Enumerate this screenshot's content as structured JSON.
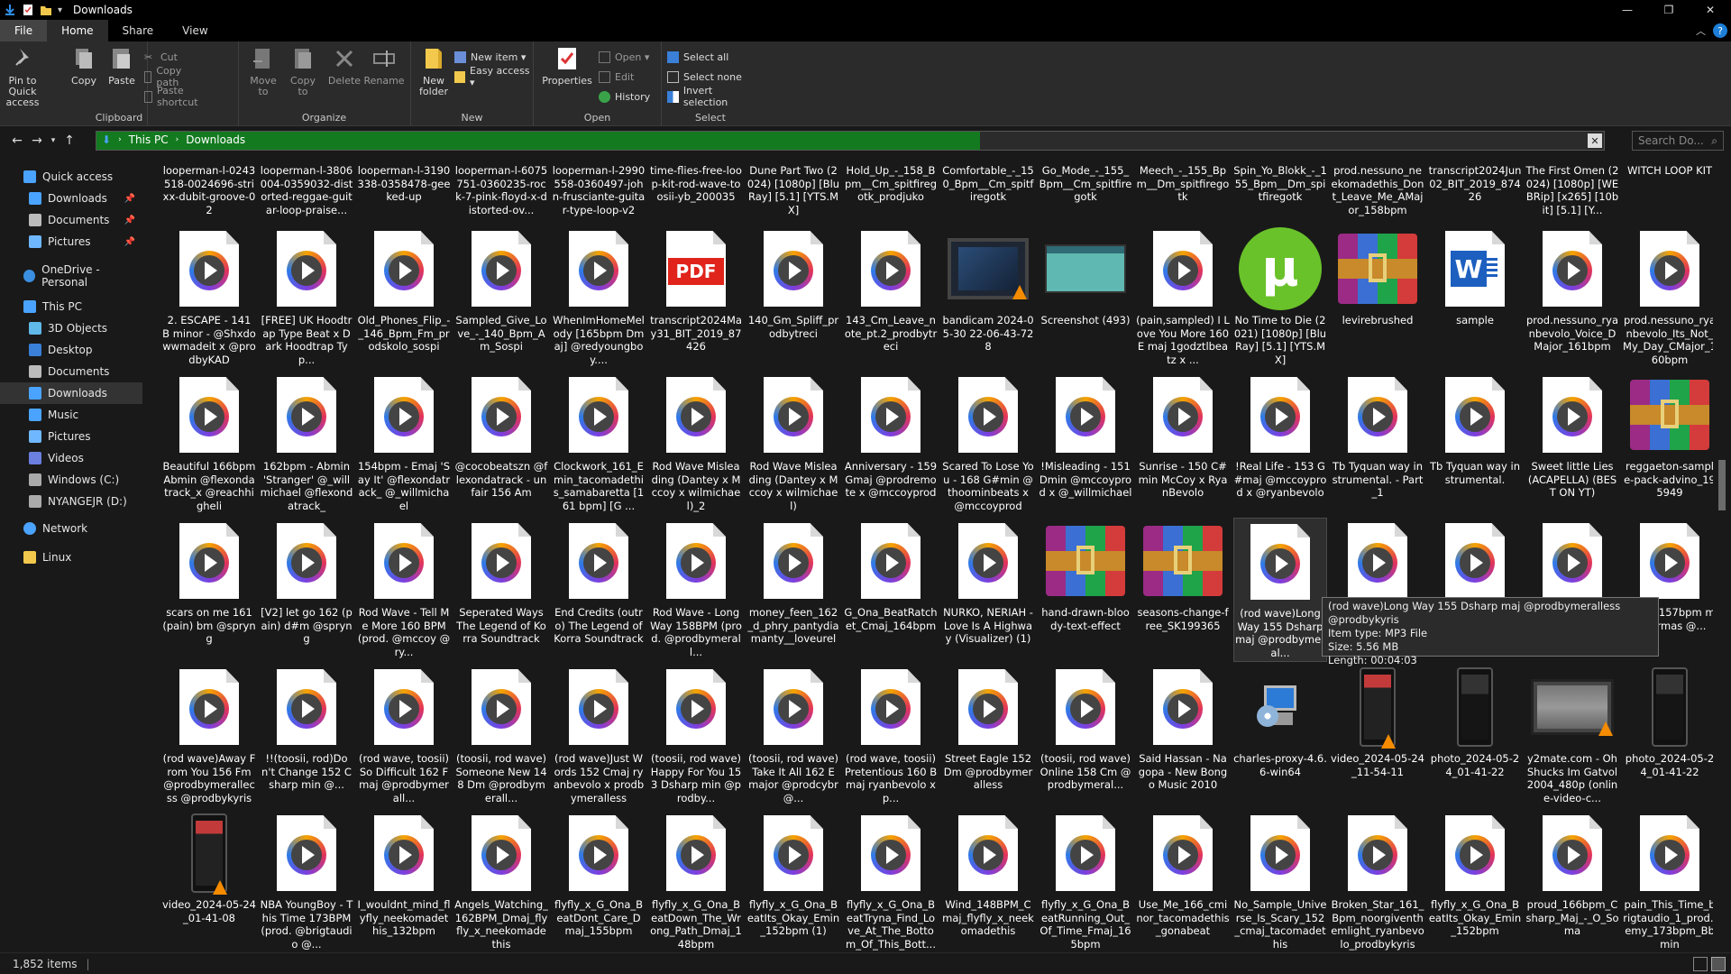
{
  "window": {
    "title": "Downloads",
    "controls": [
      "—",
      "❐",
      "✕"
    ]
  },
  "ribbon_tabs": [
    {
      "label": "File"
    },
    {
      "label": "Home"
    },
    {
      "label": "Share"
    },
    {
      "label": "View"
    }
  ],
  "ribbon": {
    "clipboard": {
      "label": "Clipboard",
      "pin": "Pin to Quick access",
      "copy": "Copy",
      "paste": "Paste",
      "cut": "Cut",
      "copy_path": "Copy path",
      "paste_shortcut": "Paste shortcut"
    },
    "organize": {
      "label": "Organize",
      "move_to": "Move to",
      "copy_to": "Copy to",
      "delete": "Delete",
      "rename": "Rename"
    },
    "new": {
      "label": "New",
      "new_folder": "New folder",
      "new_item": "New item ▾",
      "easy_access": "Easy access ▾"
    },
    "open": {
      "label": "Open",
      "properties": "Properties",
      "open": "Open ▾",
      "edit": "Edit",
      "history": "History"
    },
    "select": {
      "label": "Select",
      "select_all": "Select all",
      "select_none": "Select none",
      "invert": "Invert selection"
    }
  },
  "address": {
    "crumbs": [
      "This PC",
      "Downloads"
    ],
    "progress": 0.586,
    "search_placeholder": "Search Do..."
  },
  "nav": [
    {
      "label": "Quick access",
      "icon": "star-icon"
    },
    {
      "label": "Downloads",
      "icon": "download-icon",
      "pinned": true
    },
    {
      "label": "Documents",
      "icon": "document-icon",
      "pinned": true
    },
    {
      "label": "Pictures",
      "icon": "picture-icon",
      "pinned": true
    },
    {
      "label": "OneDrive - Personal",
      "icon": "cloud-icon"
    },
    {
      "label": "This PC",
      "icon": "computer-icon"
    },
    {
      "label": "3D Objects",
      "icon": "cube-icon"
    },
    {
      "label": "Desktop",
      "icon": "desktop-icon"
    },
    {
      "label": "Documents",
      "icon": "document-icon"
    },
    {
      "label": "Downloads",
      "icon": "download-icon",
      "selected": true
    },
    {
      "label": "Music",
      "icon": "music-icon"
    },
    {
      "label": "Pictures",
      "icon": "picture-icon"
    },
    {
      "label": "Videos",
      "icon": "video-icon"
    },
    {
      "label": "Windows (C:)",
      "icon": "drive-icon"
    },
    {
      "label": "NYANGEJR (D:)",
      "icon": "drive-icon"
    },
    {
      "label": "Network",
      "icon": "network-icon"
    },
    {
      "label": "Linux",
      "icon": "linux-icon"
    }
  ],
  "rows": [
    [
      {
        "name": "looperman-l-0243518-0024696-strixx-dubit-groove-02",
        "type": "audio"
      },
      {
        "name": "looperman-l-3806004-0359032-distorted-reggae-guitar-loop-praise...",
        "type": "audio"
      },
      {
        "name": "looperman-l-3190338-0358478-geeked-up",
        "type": "audio"
      },
      {
        "name": "looperman-l-6075751-0360235-rock-7-pink-floyd-x-distorted-ov...",
        "type": "audio"
      },
      {
        "name": "looperman-l-2990558-0360497-john-frusciante-guitar-type-loop-v2",
        "type": "audio"
      },
      {
        "name": "time-flies-free-loop-kit-rod-wave-toosii-yb_200035",
        "type": "audio"
      },
      {
        "name": "Dune Part Two (2024) [1080p] [BluRay] [5.1] [YTS.MX]",
        "type": "utorrent"
      },
      {
        "name": "Hold_Up_-_158_Bpm__Cm_spitfiregotk_prodjuko",
        "type": "audio"
      },
      {
        "name": "Comfortable_-_150_Bpm__Cm_spitfiregotk",
        "type": "audio"
      },
      {
        "name": "Go_Mode_-_155_Bpm__Cm_spitfiregotk",
        "type": "audio"
      },
      {
        "name": "Meech_-_155_Bpm__Dm_spitfiregotk",
        "type": "audio"
      },
      {
        "name": "Spin_Yo_Blokk_-_155_Bpm__Dm_spitfiregotk",
        "type": "audio"
      },
      {
        "name": "prod.nessuno_neekomadethis_Dont_Leave_Me_AMajor_158bpm",
        "type": "audio"
      },
      {
        "name": "transcript2024Jun02_BIT_2019_87426",
        "type": "pdf"
      },
      {
        "name": "The First Omen (2024) [1080p] [WEBRip] [x265] [10bit] [5.1] [Y...",
        "type": "utorrent"
      },
      {
        "name": "WITCH LOOP KIT",
        "type": "rar"
      }
    ],
    [
      {
        "name": "2. ESCAPE - 141 B minor - @Shxdowwmadeit x @prodbyKAD",
        "type": "audio"
      },
      {
        "name": "[FREE] UK Hoodtrap Type Beat x Dark Hoodtrap Typ...",
        "type": "audio"
      },
      {
        "name": "Old_Phones_Flip_-_146_Bpm_Fm_prodskolo_sospi",
        "type": "audio"
      },
      {
        "name": "Sampled_Give_Love_-_140_Bpm_Am_Sospi",
        "type": "audio"
      },
      {
        "name": "WhenImHomeMelody [165bpm Dmaj] @redyoungboy....",
        "type": "audio"
      },
      {
        "name": "transcript2024May31_BIT_2019_87426",
        "type": "pdf"
      },
      {
        "name": "140_Gm_Spliff_prodbytreci",
        "type": "audio"
      },
      {
        "name": "143_Cm_Leave_note_pt.2_prodbytreci",
        "type": "audio"
      },
      {
        "name": "bandicam 2024-05-30 22-06-43-728",
        "type": "video"
      },
      {
        "name": "Screenshot (493)",
        "type": "screenshot"
      },
      {
        "name": "(pain,sampled) I Love You More 160 E maj 1godztlbeatz x ...",
        "type": "audio"
      },
      {
        "name": "No Time to Die (2021) [1080p] [BluRay] [5.1] [YTS.MX]",
        "type": "utorrent"
      },
      {
        "name": "levirebrushed",
        "type": "rar"
      },
      {
        "name": "sample",
        "type": "word"
      },
      {
        "name": "prod.nessuno_ryanbevolo_Voice_DMajor_161bpm",
        "type": "audio"
      },
      {
        "name": "prod.nessuno_ryanbevolo_Its_Not_My_Day_CMajor_160bpm",
        "type": "audio"
      }
    ],
    [
      {
        "name": "Beautiful 166bpm Abmin @flexondatrack_x @reachhigheli",
        "type": "audio"
      },
      {
        "name": "162bpm - Abmin 'Stranger' @_willmichael @flexondatrack_",
        "type": "audio"
      },
      {
        "name": "154bpm - Emaj 'Say It' @flexondatrack_ @_willmichael",
        "type": "audio"
      },
      {
        "name": "@cocobeatszn @flexondatrack - unfair 156 Am",
        "type": "audio"
      },
      {
        "name": "Clockwork_161_Emin_tacomadethis_samabaretta [161 bpm] [G ...",
        "type": "audio"
      },
      {
        "name": "Rod Wave Misleading (Dantey x Mccoy x wilmichael)_2",
        "type": "audio"
      },
      {
        "name": "Rod Wave Misleading (Dantey x Mccoy x wilmichael)",
        "type": "audio"
      },
      {
        "name": "Anniversary - 159 Gmaj @prodremote x @mccoyprod",
        "type": "audio"
      },
      {
        "name": "Scared To Lose You - 168 G#min @thoominbeats x @mccoyprod",
        "type": "audio"
      },
      {
        "name": "!Misleading - 151 Dmin @mccoyprod x @_willmichael",
        "type": "audio"
      },
      {
        "name": "Sunrise - 150 C#min McCoy x RyanBevolo",
        "type": "audio"
      },
      {
        "name": "!Real Life - 153 G#maj @mccoyprod x @ryanbevolo",
        "type": "audio"
      },
      {
        "name": "Tb Tyquan way instrumental. - Part_1",
        "type": "audio"
      },
      {
        "name": "Tb Tyquan way instrumental.",
        "type": "audio"
      },
      {
        "name": "Sweet little Lies (ACAPELLA) (BEST ON YT)",
        "type": "audio"
      },
      {
        "name": "reggaeton-sample-pack-advino_195949",
        "type": "rar"
      }
    ],
    [
      {
        "name": "scars on me 161 (pain) bm @spryng",
        "type": "audio"
      },
      {
        "name": "[V2] let go 162 (pain) d#m @spryng",
        "type": "audio"
      },
      {
        "name": "Rod Wave - Tell Me More 160 BPM (prod. @mccoy @ry...",
        "type": "audio"
      },
      {
        "name": "Seperated Ways The Legend of Korra Soundtrack",
        "type": "audio"
      },
      {
        "name": "End Credits (outro) The Legend of Korra Soundtrack",
        "type": "audio"
      },
      {
        "name": "Rod Wave - Long Way 158BPM (prod. @prodbymerall...",
        "type": "audio"
      },
      {
        "name": "money_feen_162_d_phry_pantydiamanty__loveurel",
        "type": "audio"
      },
      {
        "name": "G_Ona_BeatRatchet_Cmaj_164bpm",
        "type": "audio"
      },
      {
        "name": "NURKO, NERIAH - Love Is A Highway (Visualizer) (1)",
        "type": "audio"
      },
      {
        "name": "hand-drawn-bloody-text-effect",
        "type": "rar"
      },
      {
        "name": "seasons-change-free_SK199365",
        "type": "rar"
      },
      {
        "name": "(rod wave)Long Way 155 Dsharp maj @prodbymeral...",
        "type": "audio",
        "hover": true
      },
      {
        "name": "",
        "type": "audio"
      },
      {
        "name": "",
        "type": "audio"
      },
      {
        "name": "",
        "type": "audio"
      },
      {
        "name": "wave) 157bpm minor rmas @...",
        "type": "audio"
      }
    ],
    [
      {
        "name": "(rod wave)Away From You 156 Fm @prodbymerallecss @prodbykyris",
        "type": "audio"
      },
      {
        "name": "!!(toosii, rod)Don't Change 152 Csharp min @...",
        "type": "audio"
      },
      {
        "name": "(rod wave, toosii)So Difficult 162 Fmaj @prodbymerall...",
        "type": "audio"
      },
      {
        "name": "(toosii, rod wave)Someone New 148 Dm @prodbymerall...",
        "type": "audio"
      },
      {
        "name": "(rod wave)Just Words 152 Cmaj ryanbevolo x prodbymeralless",
        "type": "audio"
      },
      {
        "name": "(toosii, rod wave)Happy For You 153 Dsharp min @prodby...",
        "type": "audio"
      },
      {
        "name": "(toosii, rod wave)Take It All 162 E major @prodcybr @...",
        "type": "audio"
      },
      {
        "name": "(rod wave, toosii)Pretentious 160 Bmaj ryanbevolo x p...",
        "type": "audio"
      },
      {
        "name": "Street Eagle 152 Dm @prodbymeralless",
        "type": "audio"
      },
      {
        "name": "(toosii, rod wave)Online 158 Cm @prodbymeral...",
        "type": "audio"
      },
      {
        "name": "Said Hassan - Nagopa - New Bongo Music 2010",
        "type": "audio"
      },
      {
        "name": "charles-proxy-4.6.6-win64",
        "type": "exe"
      },
      {
        "name": "video_2024-05-24_11-54-11",
        "type": "phone-video"
      },
      {
        "name": "photo_2024-05-24_01-41-22",
        "type": "phone-photo"
      },
      {
        "name": "y2mate.com - Oh Shucks Im Gatvol 2004_480p (online-video-c...",
        "type": "wide-video"
      },
      {
        "name": "photo_2024-05-24_01-41-22",
        "type": "phone-photo"
      }
    ],
    [
      {
        "name": "video_2024-05-24_01-41-08",
        "type": "phone-video"
      },
      {
        "name": "NBA YoungBoy - This Time 173BPM (prod. @brigtaudio @...",
        "type": "audio"
      },
      {
        "name": "I_wouldnt_mind_flyfly_neekomadethis_132bpm",
        "type": "audio"
      },
      {
        "name": "Angels_Watching_162BPM_Dmaj_flyfly_x_neekomadethis",
        "type": "audio"
      },
      {
        "name": "flyfly_x_G_Ona_BeatDont_Care_Dmaj_155bpm",
        "type": "audio"
      },
      {
        "name": "flyfly_x_G_Ona_BeatDown_The_Wrong_Path_Dmaj_148bpm",
        "type": "audio"
      },
      {
        "name": "flyfly_x_G_Ona_BeatIts_Okay_Emin_152bpm (1)",
        "type": "audio"
      },
      {
        "name": "flyfly_x_G_Ona_BeatTryna_Find_Love_At_The_Bottom_Of_This_Bott...",
        "type": "audio"
      },
      {
        "name": "Wind_148BPM_Cmaj_flyfly_x_neekomadethis",
        "type": "audio"
      },
      {
        "name": "flyfly_x_G_Ona_BeatRunning_Out_Of_Time_Fmaj_165bpm",
        "type": "audio"
      },
      {
        "name": "Use_Me_166_cminor_tacomadethis_gonabeat",
        "type": "audio"
      },
      {
        "name": "No_Sample_Universe_Is_Scary_152_cmaj_tacomadethis",
        "type": "audio"
      },
      {
        "name": "Broken_Star_161_Bpm_noorgiventhemlight_ryanbevolo_prodbykyris",
        "type": "audio"
      },
      {
        "name": "flyfly_x_G_Ona_BeatIts_Okay_Emin_152bpm",
        "type": "audio"
      },
      {
        "name": "proud_166bpm_Csharp_Maj_-_O_Soma",
        "type": "audio"
      },
      {
        "name": "pain_This_Time_brigtaudio_1_prod.lemy_173bpm_Bbmin",
        "type": "audio"
      }
    ]
  ],
  "tooltip": {
    "lines": [
      "(rod wave)Long Way 155 Dsharp maj @prodbymeralless @prodbykyris",
      "Item type: MP3 File",
      "Size: 5.56 MB",
      "Length: 00:04:03"
    ]
  },
  "status": {
    "count": "1,852 items"
  }
}
